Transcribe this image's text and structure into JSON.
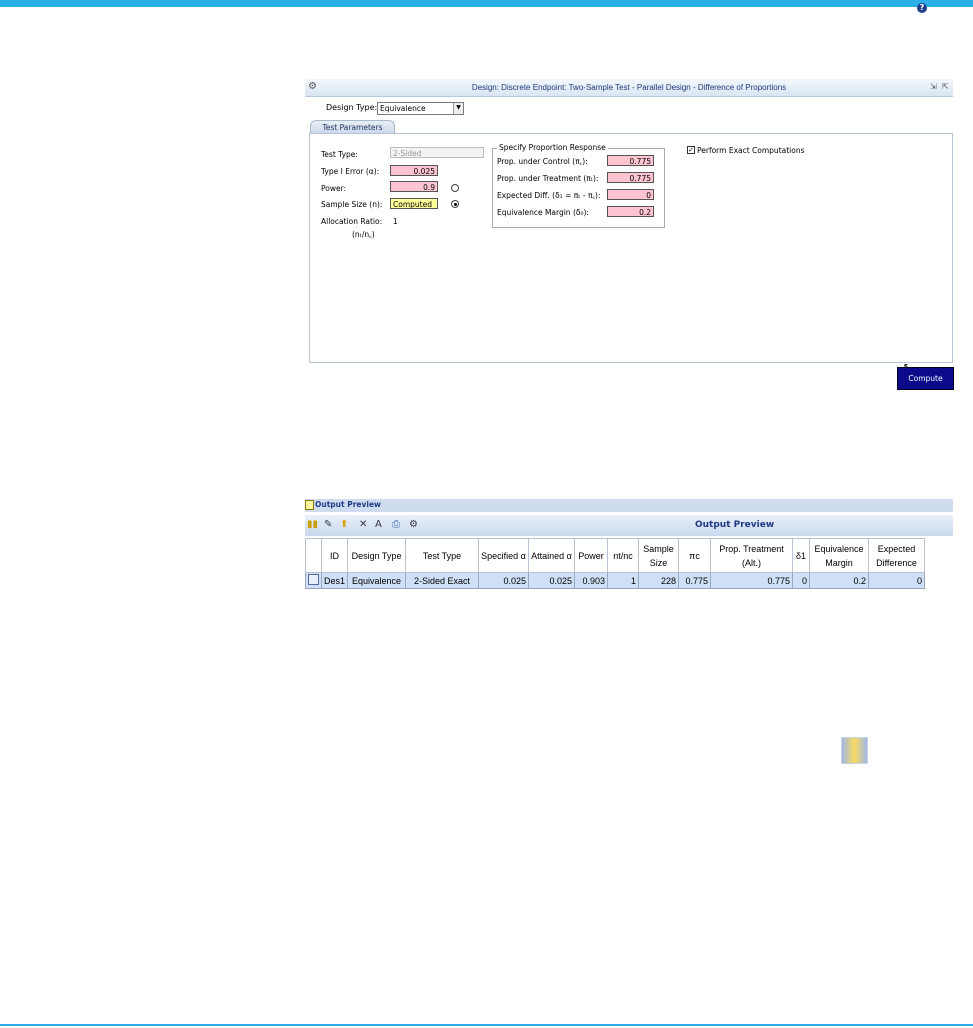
{
  "design_panel": {
    "title": "Design: Discrete Endpoint: Two-Sample Test - Parallel Design - Difference of Proportions",
    "design_type_label": "Design Type:",
    "design_type_value": "Equivalence",
    "tab_label": "Test Parameters",
    "test_type_label": "Test Type:",
    "test_type_value": "2-Sided",
    "type1_label": "Type I Error (α):",
    "type1_value": "0.025",
    "power_label": "Power:",
    "power_value": "0.9",
    "sample_size_label": "Sample Size (n):",
    "sample_size_value": "Computed",
    "allocation_label": "Allocation Ratio:",
    "allocation_value": "1",
    "allocation_sub": "(nₜ/n꜀)",
    "group_title": "Specify Proportion Response",
    "prop_control_label": "Prop. under Control (π꜀):",
    "prop_control_value": "0.775",
    "prop_treatment_label": "Prop. under Treatment (πₜ):",
    "prop_treatment_value": "0.775",
    "expected_diff_label": "Expected Diff. (δ₁ = πₜ - π꜀):",
    "expected_diff_value": "0",
    "margin_label": "Equivalence Margin (δ₀):",
    "margin_value": "0.2",
    "exact_label": "Perform Exact Computations",
    "exact_checked": true,
    "compute_label": "Compute"
  },
  "output_preview": {
    "section_title": "Output Preview",
    "toolbar_title": "Output Preview",
    "columns": [
      "ID",
      "Design Type",
      "Test Type",
      "Specified α",
      "Attained α",
      "Power",
      "nt/nc",
      "Sample Size",
      "πc",
      "Prop. Treatment (Alt.)",
      "δ1",
      "Equivalence Margin",
      "Expected Difference"
    ],
    "rows": [
      [
        "Des1",
        "Equivalence",
        "2-Sided Exact",
        "0.025",
        "0.025",
        "0.903",
        "1",
        "228",
        "0.775",
        "0.775",
        "0",
        "0.2",
        "0"
      ]
    ]
  },
  "colors": {
    "accent": "#2ab0e6",
    "input_pink": "#ffc4d1",
    "computed_yellow": "#ffff99",
    "compute_button": "#0a0a8a",
    "row_blue": "#cfe0f6"
  }
}
